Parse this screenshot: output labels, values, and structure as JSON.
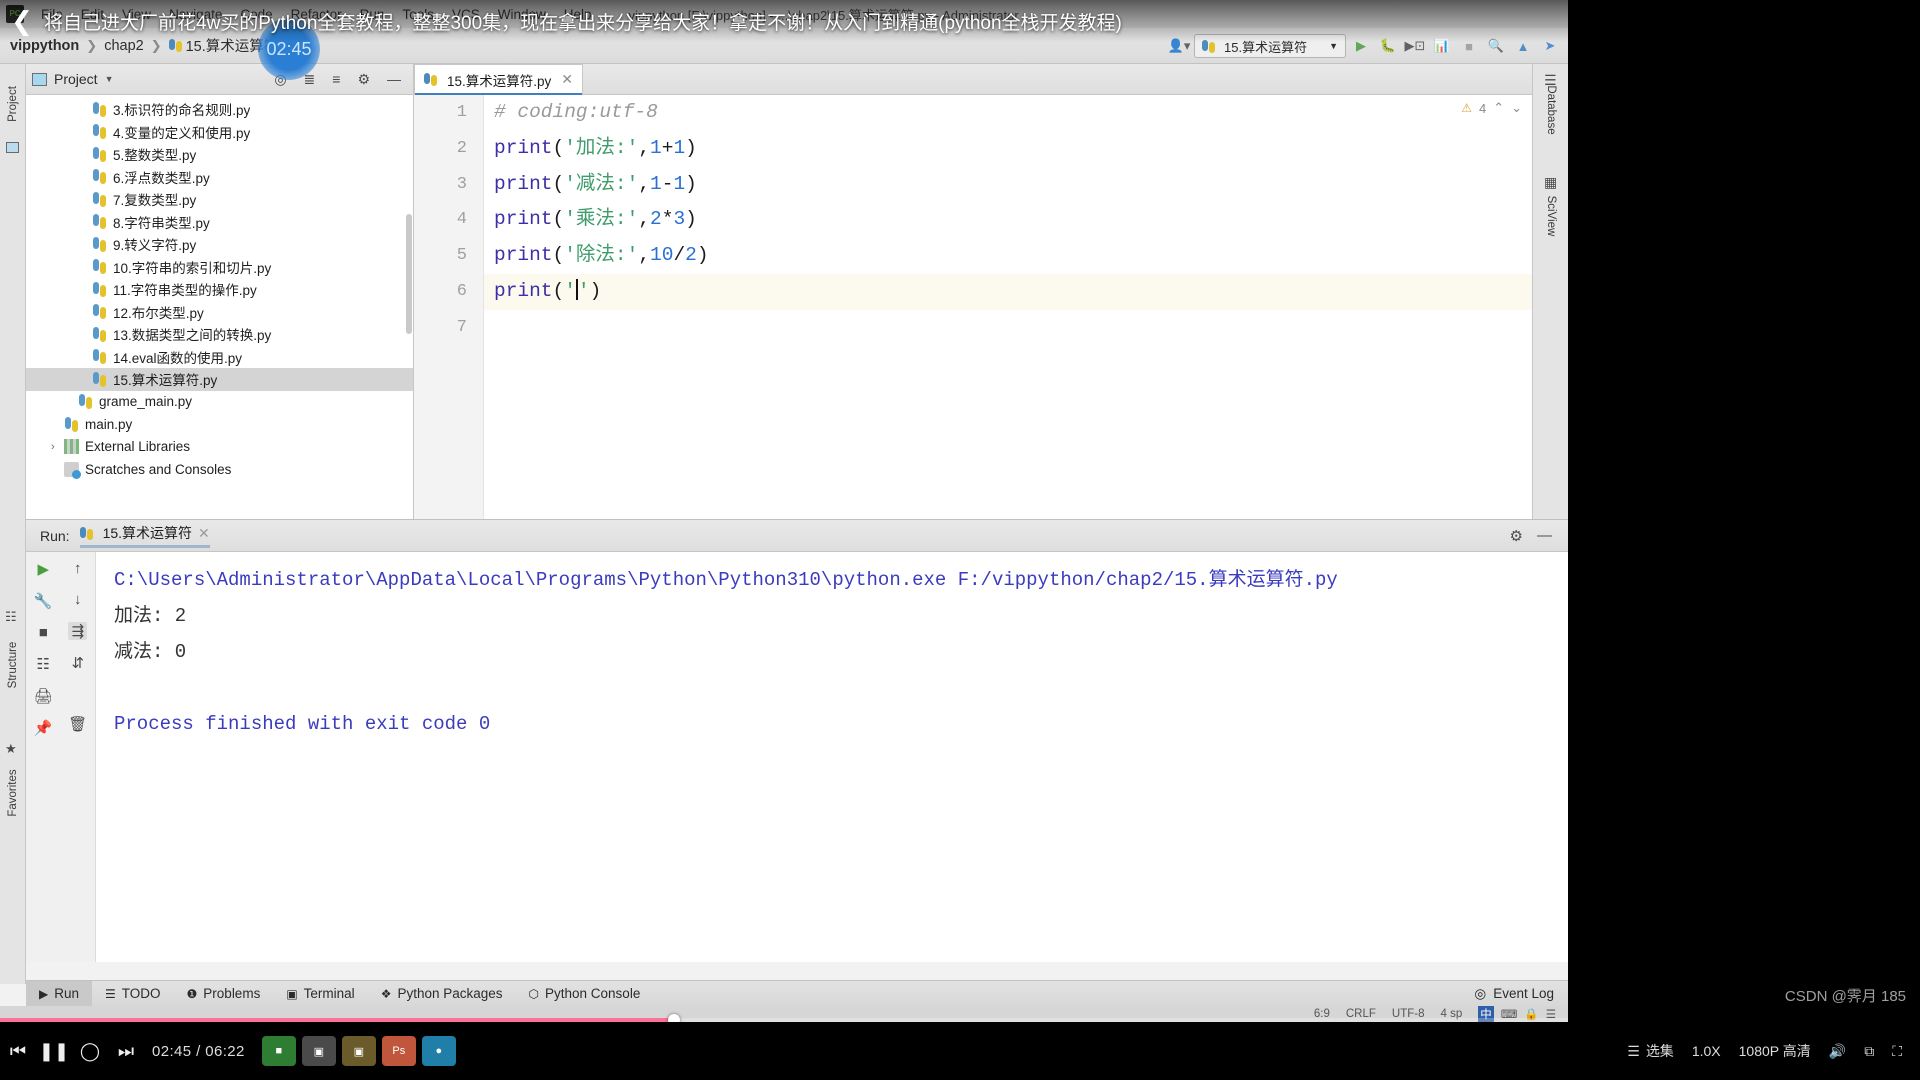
{
  "player": {
    "video_title": "将自己进大厂前花4w买的Python全套教程，整整300集，现在拿出来分享给大家！拿走不谢！从入门到精通(python全栈开发教程)",
    "back_icon": "back-chevron-icon",
    "buffer_time": "02:45",
    "time_display": "02:45 / 06:22",
    "prev_icon": "previous-track-icon",
    "pause_icon": "pause-icon",
    "stop_icon": "stop-icon",
    "next_icon": "next-track-icon",
    "episodes_label": "选集",
    "speed_label": "1.0X",
    "quality_label": "1080P 高清",
    "volume_icon": "volume-icon",
    "pip_icon": "picture-in-picture-icon",
    "fullscreen_icon": "fullscreen-icon",
    "watermark": "CSDN @霁月 185",
    "progress_percent": 43,
    "accent_color": "#fb7299"
  },
  "ide": {
    "window_title": "vippython [F:\\vippython] - ...\\chap2\\15.算术运算符.py - Administrator",
    "logo": "PC",
    "menu": [
      "File",
      "Edit",
      "View",
      "Navigate",
      "Code",
      "Refactor",
      "Run",
      "Tools",
      "VCS",
      "Window",
      "Help"
    ],
    "breadcrumb": {
      "project": "vippython",
      "folder": "chap2",
      "file": "15.算术运算符.py"
    },
    "toolbar": {
      "user_icon": "user-account-icon",
      "run_config": "15.算术运算符",
      "run_icon": "run-icon",
      "debug_icon": "debug-icon",
      "coverage_icon": "coverage-icon",
      "profile_icon": "profile-icon",
      "stop_icon": "stop-icon",
      "search_icon": "search-icon",
      "update_icon": "update-project-icon",
      "push_icon": "push-commit-icon"
    },
    "left_strip": [
      "Project",
      "Structure",
      "Favorites"
    ],
    "right_strip": [
      "Database",
      "SciView"
    ],
    "project_panel": {
      "title": "Project",
      "icons": [
        "locate-icon",
        "collapse-all-icon",
        "expand-all-icon",
        "settings-gear-icon",
        "hide-icon"
      ],
      "tree": [
        {
          "label": "3.标识符的命名规则.py",
          "icon": "python-file-icon",
          "level": 3,
          "selected": false
        },
        {
          "label": "4.变量的定义和使用.py",
          "icon": "python-file-icon",
          "level": 3,
          "selected": false
        },
        {
          "label": "5.整数类型.py",
          "icon": "python-file-icon",
          "level": 3,
          "selected": false
        },
        {
          "label": "6.浮点数类型.py",
          "icon": "python-file-icon",
          "level": 3,
          "selected": false
        },
        {
          "label": "7.复数类型.py",
          "icon": "python-file-icon",
          "level": 3,
          "selected": false
        },
        {
          "label": "8.字符串类型.py",
          "icon": "python-file-icon",
          "level": 3,
          "selected": false
        },
        {
          "label": "9.转义字符.py",
          "icon": "python-file-icon",
          "level": 3,
          "selected": false
        },
        {
          "label": "10.字符串的索引和切片.py",
          "icon": "python-file-icon",
          "level": 3,
          "selected": false
        },
        {
          "label": "11.字符串类型的操作.py",
          "icon": "python-file-icon",
          "level": 3,
          "selected": false
        },
        {
          "label": "12.布尔类型.py",
          "icon": "python-file-icon",
          "level": 3,
          "selected": false
        },
        {
          "label": "13.数据类型之间的转换.py",
          "icon": "python-file-icon",
          "level": 3,
          "selected": false
        },
        {
          "label": "14.eval函数的使用.py",
          "icon": "python-file-icon",
          "level": 3,
          "selected": false
        },
        {
          "label": "15.算术运算符.py",
          "icon": "python-file-icon",
          "level": 3,
          "selected": true
        },
        {
          "label": "grame_main.py",
          "icon": "python-file-icon",
          "level": 2,
          "selected": false
        },
        {
          "label": "main.py",
          "icon": "python-file-icon",
          "level": 1,
          "selected": false
        },
        {
          "label": "External Libraries",
          "icon": "library-icon",
          "level": 1,
          "selected": false,
          "arrow": "›"
        },
        {
          "label": "Scratches and Consoles",
          "icon": "scratches-icon",
          "level": 1,
          "selected": false
        }
      ]
    },
    "editor": {
      "tab": "15.算术运算符.py",
      "tab_icon": "python-file-icon",
      "close_icon": "close-icon",
      "warning_count": "4",
      "warning_icon": "warning-triangle-icon",
      "up_icon": "prev-highlight-icon",
      "down_icon": "next-highlight-icon",
      "lines": [
        {
          "n": "1",
          "tokens": [
            {
              "t": "# coding:utf-8",
              "c": "cmt"
            }
          ]
        },
        {
          "n": "2",
          "tokens": [
            {
              "t": "print",
              "c": "kw"
            },
            {
              "t": "(",
              "c": "pun"
            },
            {
              "t": "'加法:'",
              "c": "str"
            },
            {
              "t": ",",
              "c": "pun"
            },
            {
              "t": "1",
              "c": "num"
            },
            {
              "t": "+",
              "c": "pun"
            },
            {
              "t": "1",
              "c": "num"
            },
            {
              "t": ")",
              "c": "pun"
            }
          ]
        },
        {
          "n": "3",
          "tokens": [
            {
              "t": "print",
              "c": "kw"
            },
            {
              "t": "(",
              "c": "pun"
            },
            {
              "t": "'减法:'",
              "c": "str"
            },
            {
              "t": ",",
              "c": "pun"
            },
            {
              "t": "1",
              "c": "num"
            },
            {
              "t": "-",
              "c": "pun"
            },
            {
              "t": "1",
              "c": "num"
            },
            {
              "t": ")",
              "c": "pun"
            }
          ]
        },
        {
          "n": "4",
          "tokens": [
            {
              "t": "print",
              "c": "kw"
            },
            {
              "t": "(",
              "c": "pun"
            },
            {
              "t": "'乘法:'",
              "c": "str"
            },
            {
              "t": ",",
              "c": "pun"
            },
            {
              "t": "2",
              "c": "num"
            },
            {
              "t": "*",
              "c": "pun"
            },
            {
              "t": "3",
              "c": "num"
            },
            {
              "t": ")",
              "c": "pun"
            }
          ]
        },
        {
          "n": "5",
          "tokens": [
            {
              "t": "print",
              "c": "kw"
            },
            {
              "t": "(",
              "c": "pun"
            },
            {
              "t": "'除法:'",
              "c": "str"
            },
            {
              "t": ",",
              "c": "pun"
            },
            {
              "t": "10",
              "c": "num"
            },
            {
              "t": "/",
              "c": "pun"
            },
            {
              "t": "2",
              "c": "num"
            },
            {
              "t": ")",
              "c": "pun"
            }
          ]
        },
        {
          "n": "6",
          "tokens": [
            {
              "t": "print",
              "c": "kw"
            },
            {
              "t": "(",
              "c": "pun"
            },
            {
              "t": "'",
              "c": "str"
            },
            {
              "t": "CARET",
              "c": "caret"
            },
            {
              "t": "'",
              "c": "str"
            },
            {
              "t": ")",
              "c": "pun"
            }
          ],
          "current": true
        },
        {
          "n": "7",
          "tokens": []
        }
      ]
    },
    "run_window": {
      "label": "Run:",
      "tab": "15.算术运算符",
      "tab_icon": "python-file-icon",
      "close_icon": "close-icon",
      "settings_icon": "settings-gear-icon",
      "minimize_icon": "minimize-icon",
      "side_icons": [
        "rerun-icon",
        "scroll-up-icon",
        "wrench-icon",
        "scroll-down-icon",
        "stop-icon",
        "soft-wrap-icon",
        "print-icon",
        "scroll-to-end-icon",
        "pin-icon",
        "trash-icon"
      ],
      "output": [
        {
          "text": "C:\\Users\\Administrator\\AppData\\Local\\Programs\\Python\\Python310\\python.exe F:/vippython/chap2/15.算术运算符.py",
          "style": "path"
        },
        {
          "text": "加法: 2",
          "style": "plain"
        },
        {
          "text": "减法: 0",
          "style": "plain"
        },
        {
          "text": "",
          "style": "plain"
        },
        {
          "text": "Process finished with exit code 0",
          "style": "fin"
        }
      ]
    },
    "bottom_bar": {
      "items": [
        {
          "label": "Run",
          "icon": "run-icon",
          "active": true
        },
        {
          "label": "TODO",
          "icon": "todo-list-icon",
          "active": false
        },
        {
          "label": "Problems",
          "icon": "problems-icon",
          "active": false
        },
        {
          "label": "Terminal",
          "icon": "terminal-icon",
          "active": false
        },
        {
          "label": "Python Packages",
          "icon": "packages-icon",
          "active": false
        },
        {
          "label": "Python Console",
          "icon": "python-console-icon",
          "active": false
        }
      ],
      "event_log": "Event Log",
      "event_log_icon": "event-log-icon"
    },
    "status_bar": {
      "caret": "6:9",
      "line_sep": "CRLF",
      "encoding": "UTF-8",
      "indent": "4 sp",
      "icons": [
        "ime-icon",
        "keyboard-icon",
        "lock-icon",
        "notification-icon"
      ]
    }
  }
}
